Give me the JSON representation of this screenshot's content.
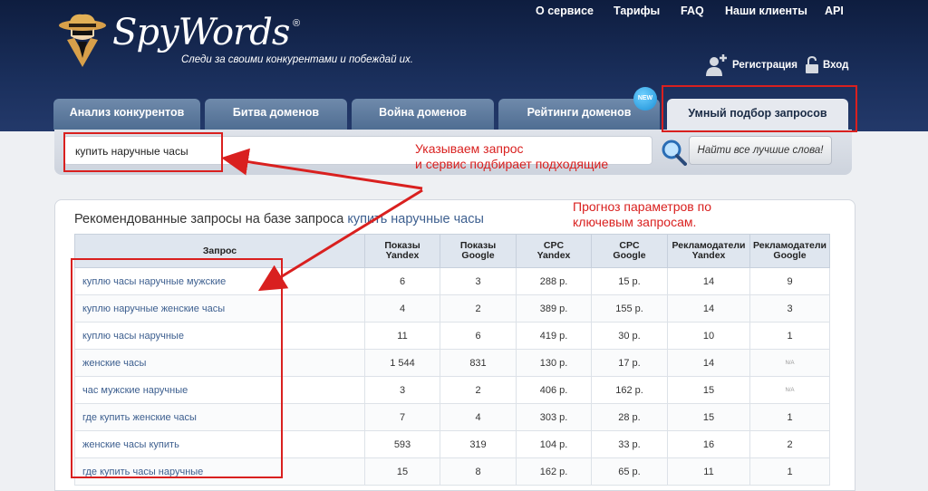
{
  "logo": {
    "text": "SpyWords",
    "reg": "®",
    "tagline": "Следи за своими конкурентами и побеждай их."
  },
  "topnav": [
    "О сервисе",
    "Тарифы",
    "FAQ",
    "Наши клиенты",
    "API"
  ],
  "auth": {
    "register": "Регистрация",
    "login": "Вход"
  },
  "tabs": [
    "Анализ конкурентов",
    "Битва доменов",
    "Война доменов",
    "Рейтинги доменов",
    "Умный подбор запросов"
  ],
  "new_badge": "NEW",
  "search": {
    "value": "купить наручные часы",
    "button": "Найти все лучшие слова!"
  },
  "annotations": {
    "a1": "Указываем запрос\nи сервис подбирает подходящие",
    "a2": "Прогноз параметров по\nключевым запросам."
  },
  "results": {
    "title_prefix": "Рекомендованные запросы на базе запроса ",
    "title_query": "купить наручные часы",
    "headers": [
      "Запрос",
      "Показы\nYandex",
      "Показы\nGoogle",
      "CPC\nYandex",
      "CPC\nGoogle",
      "Рекламодатели\nYandex",
      "Рекламодатели\nGoogle"
    ],
    "rows": [
      [
        "куплю часы наручные мужские",
        "6",
        "3",
        "288 р.",
        "15 р.",
        "14",
        "9"
      ],
      [
        "куплю наручные женские часы",
        "4",
        "2",
        "389 р.",
        "155 р.",
        "14",
        "3"
      ],
      [
        "куплю часы наручные",
        "11",
        "6",
        "419 р.",
        "30 р.",
        "10",
        "1"
      ],
      [
        "женские часы",
        "1 544",
        "831",
        "130 р.",
        "17 р.",
        "14",
        "N/A"
      ],
      [
        "час мужские наручные",
        "3",
        "2",
        "406 р.",
        "162 р.",
        "15",
        "N/A"
      ],
      [
        "где купить женские часы",
        "7",
        "4",
        "303 р.",
        "28 р.",
        "15",
        "1"
      ],
      [
        "женские часы купить",
        "593",
        "319",
        "104 р.",
        "33 р.",
        "16",
        "2"
      ],
      [
        "где купить часы наручные",
        "15",
        "8",
        "162 р.",
        "65 р.",
        "11",
        "1"
      ]
    ]
  },
  "colors": {
    "header_bg": "#1a2f5c",
    "accent_red": "#d9201f",
    "link_blue": "#3d5f8f"
  }
}
